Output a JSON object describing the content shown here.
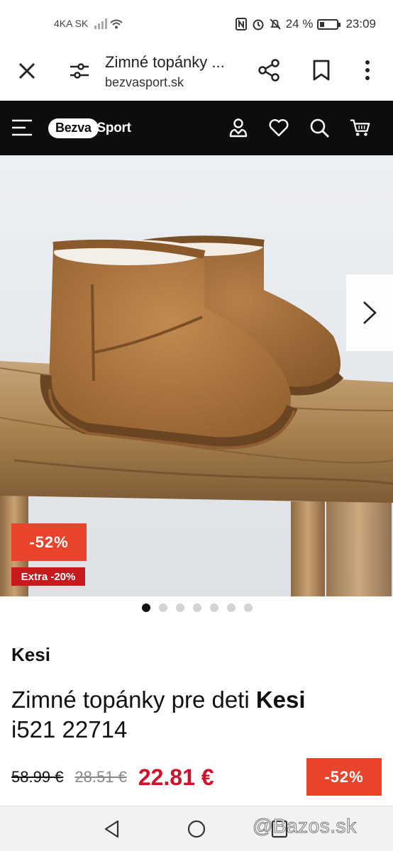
{
  "status_bar": {
    "carrier": "4KA SK",
    "battery": "24 %",
    "time": "23:09",
    "icons": [
      "signal-icon",
      "wifi-icon",
      "nfc-icon",
      "alarm-icon",
      "mute-icon",
      "battery-icon"
    ]
  },
  "browser": {
    "page_title": "Zimné topánky ...",
    "url": "bezvasport.sk",
    "icons": [
      "close-icon",
      "tune-icon",
      "share-icon",
      "bookmark-icon",
      "more-vert-icon"
    ]
  },
  "site_header": {
    "logo_part1": "Bezva",
    "logo_part2": "Sport",
    "icons": [
      "menu-icon",
      "account-icon",
      "heart-icon",
      "search-icon",
      "cart-icon"
    ]
  },
  "gallery": {
    "discount_badge": "-52%",
    "extra_badge": "Extra -20%",
    "image_count": 7,
    "active_index": 0,
    "icons": [
      "chevron-right-icon"
    ]
  },
  "product": {
    "brand": "Kesi",
    "name_prefix": "Zimné topánky pre deti ",
    "name_brand": "Kesi",
    "name_code": "i521 22714",
    "price_original": "58.99 €",
    "price_previous": "28.51 €",
    "price_current": "22.81 €",
    "discount_badge": "-52%"
  },
  "nav_bar": {
    "icons": [
      "back-icon",
      "home-icon",
      "recent-apps-icon"
    ],
    "watermark": "@Bazos.sk"
  },
  "colors": {
    "header_bg": "#0d0d0d",
    "discount": "#e8442b",
    "extra": "#c8191e",
    "price_current": "#d0112b"
  }
}
